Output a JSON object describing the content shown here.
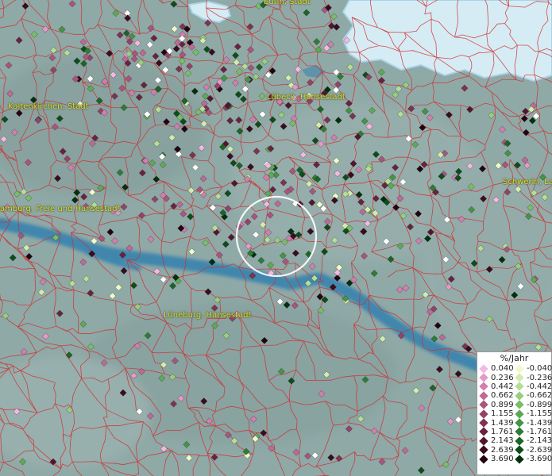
{
  "cities": [
    {
      "name": "Eutin, Stadt"
    },
    {
      "name": "Kaltenkirchen, Stadt"
    },
    {
      "name": "Lübeck, Hansestadt"
    },
    {
      "name": "Schwerin, La"
    },
    {
      "name": "amburg, Freie und Hansestadt"
    },
    {
      "name": "Lüneburg, Hansestadt"
    }
  ],
  "legend": {
    "title": "%/Jahr",
    "positive": [
      {
        "value": "0.040",
        "color": "#f4b8e2"
      },
      {
        "value": "0.236",
        "color": "#e29ac8"
      },
      {
        "value": "0.442",
        "color": "#d07fae"
      },
      {
        "value": "0.662",
        "color": "#bd6a95"
      },
      {
        "value": "0.899",
        "color": "#a9557d"
      },
      {
        "value": "1.155",
        "color": "#944366"
      },
      {
        "value": "1.439",
        "color": "#7e3351"
      },
      {
        "value": "1.761",
        "color": "#68243e"
      },
      {
        "value": "2.143",
        "color": "#51172d"
      },
      {
        "value": "2.639",
        "color": "#3a0c1e"
      },
      {
        "value": "3.690",
        "color": "#240310"
      }
    ],
    "negative": [
      {
        "value": "-0.040",
        "color": "#eefac8"
      },
      {
        "value": "-0.236",
        "color": "#d2ecae"
      },
      {
        "value": "-0.442",
        "color": "#b6de96"
      },
      {
        "value": "-0.662",
        "color": "#98ce7e"
      },
      {
        "value": "-0.899",
        "color": "#7abd68"
      },
      {
        "value": "-1.155",
        "color": "#5ea955"
      },
      {
        "value": "-1.439",
        "color": "#449444"
      },
      {
        "value": "-1.761",
        "color": "#2e7d35"
      },
      {
        "value": "-2.143",
        "color": "#1b6527"
      },
      {
        "value": "-2.639",
        "color": "#0d4d1a"
      },
      {
        "value": "-3.690",
        "color": "#03300e"
      }
    ]
  },
  "colors": {
    "land": "#8fa9a7",
    "water": "#3f86ad",
    "sea": "#d6ecf5",
    "boundary": "#cf2f2f",
    "label": "#e8e21a",
    "highlight_ring": "#ffffff"
  }
}
